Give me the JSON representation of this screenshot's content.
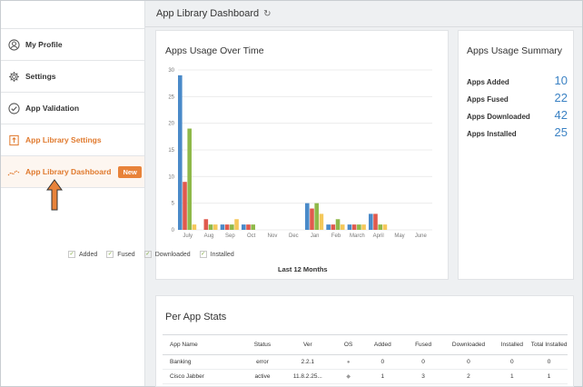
{
  "header": {
    "title": "App Library Dashboard",
    "refresh_icon": "refresh-icon"
  },
  "sidebar": {
    "items": [
      {
        "label": "My Profile",
        "icon": "user-icon"
      },
      {
        "label": "Settings",
        "icon": "gear-icon"
      },
      {
        "label": "App Validation",
        "icon": "check-circle-icon"
      },
      {
        "label": "App Library Settings",
        "icon": "upload-box-icon"
      },
      {
        "label": "App Library Dashboard",
        "icon": "trend-chart-icon",
        "badge": "New"
      }
    ]
  },
  "usage_card": {
    "title": "Apps Usage Over Time",
    "xlabel": "Last 12 Months"
  },
  "summary": {
    "title": "Apps Usage Summary",
    "rows": [
      {
        "label": "Apps Added",
        "value": "10"
      },
      {
        "label": "Apps Fused",
        "value": "22"
      },
      {
        "label": "Apps Downloaded",
        "value": "42"
      },
      {
        "label": "Apps Installed",
        "value": "25"
      }
    ]
  },
  "stats": {
    "title": "Per App Stats",
    "columns": [
      "App Name",
      "Status",
      "Ver",
      "OS",
      "Added",
      "Fused",
      "Downloaded",
      "Installed",
      "Total Installed"
    ],
    "rows": [
      [
        "Banking",
        "error",
        "2.2.1",
        "",
        "0",
        "0",
        "0",
        "0",
        "0"
      ],
      [
        "Cisco Jabber",
        "active",
        "11.8.2.25...",
        "",
        "1",
        "3",
        "2",
        "1",
        "1"
      ]
    ]
  },
  "chart_data": {
    "type": "bar",
    "categories": [
      "July",
      "Aug",
      "Sep",
      "Oct",
      "Nov",
      "Dec",
      "Jan",
      "Feb",
      "March",
      "April",
      "May",
      "June"
    ],
    "series": [
      {
        "name": "Added",
        "color": "#4a8ac9",
        "values": [
          29,
          0,
          1,
          1,
          0,
          0,
          5,
          1,
          1,
          3,
          0,
          0
        ]
      },
      {
        "name": "Fused",
        "color": "#e05a4e",
        "values": [
          9,
          2,
          1,
          1,
          0,
          0,
          4,
          1,
          1,
          3,
          0,
          0
        ]
      },
      {
        "name": "Downloaded",
        "color": "#8fb94a",
        "values": [
          19,
          1,
          1,
          1,
          0,
          0,
          5,
          2,
          1,
          1,
          0,
          0
        ]
      },
      {
        "name": "Installed",
        "color": "#f5c85a",
        "values": [
          1,
          1,
          2,
          0,
          0,
          0,
          3,
          1,
          1,
          1,
          0,
          0
        ]
      }
    ],
    "yticks": [
      0,
      5,
      10,
      15,
      20,
      25,
      30
    ],
    "ylim": [
      0,
      30
    ],
    "grid": true,
    "legend": "bottom",
    "xlabel": "Last 12 Months"
  }
}
